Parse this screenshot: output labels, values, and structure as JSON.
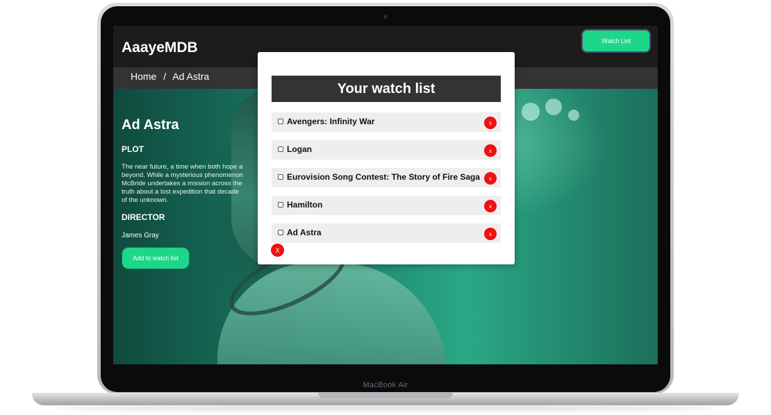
{
  "device": {
    "brand_label": "MacBook Air"
  },
  "app": {
    "logo": "AaayeMDB",
    "watch_list_button": "Watch List"
  },
  "breadcrumb": {
    "home": "Home",
    "separator": "/",
    "current": "Ad Astra"
  },
  "movie": {
    "title": "Ad Astra",
    "plot_heading": "PLOT",
    "plot_text": "The near future, a time when both hope a\nbeyond. While a mysterious phenomenon\nMcBride undertakes a mission across the\ntruth about a lost expedition that decade\nof the unknown.",
    "director_heading": "DIRECTOR",
    "director": "James Gray",
    "add_button": "Add to watch list"
  },
  "watchlist_modal": {
    "title": "Your watch list",
    "items": [
      {
        "label": "Avengers: Infinity War",
        "remove": "x"
      },
      {
        "label": "Logan",
        "remove": "x"
      },
      {
        "label": "Eurovision Song Contest: The Story of Fire Saga",
        "remove": "x"
      },
      {
        "label": "Hamilton",
        "remove": "x"
      },
      {
        "label": "Ad Astra",
        "remove": "x"
      }
    ],
    "close_label": "X"
  },
  "colors": {
    "accent": "#1dd68a",
    "danger": "#ee1111",
    "bar": "#333333"
  }
}
